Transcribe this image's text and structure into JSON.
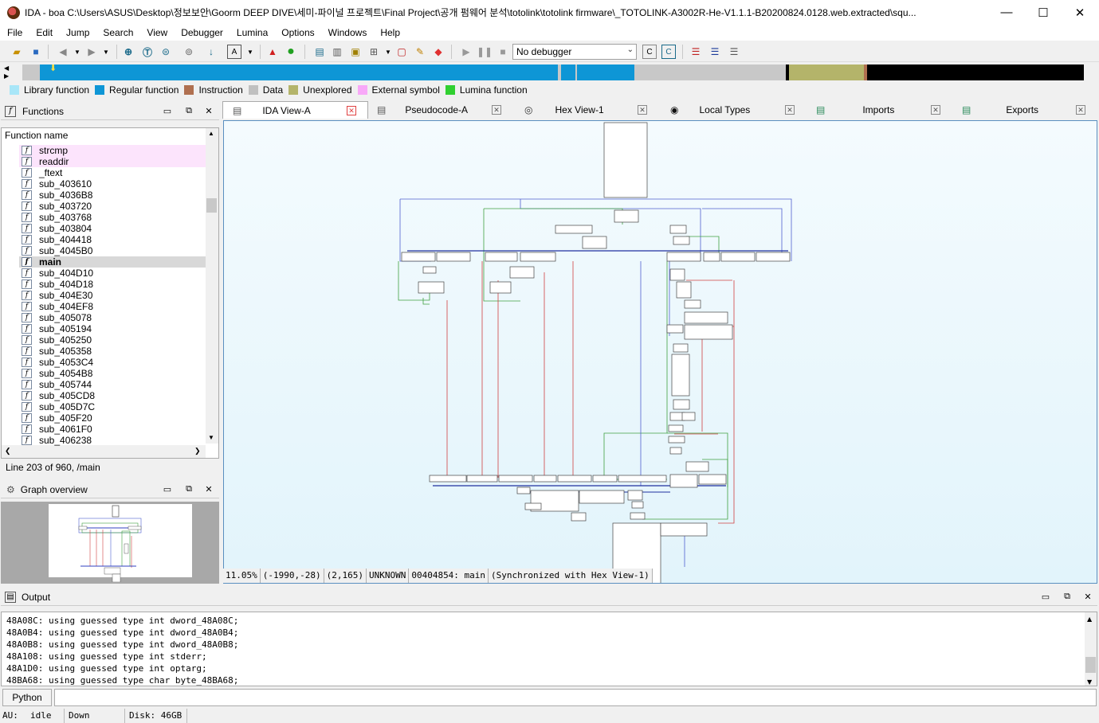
{
  "window": {
    "title": "IDA - boa C:\\Users\\ASUS\\Desktop\\정보보안\\Goorm DEEP DIVE\\세미-파이널 프로젝트\\Final Project\\공개 펌웨어 분석\\totolink\\totolink firmware\\_TOTOLINK-A3002R-He-V1.1.1-B20200824.0128.web.extracted\\squ...",
    "minimize": "—",
    "maximize": "☐",
    "close": "✕"
  },
  "menu": [
    "File",
    "Edit",
    "Jump",
    "Search",
    "View",
    "Debugger",
    "Lumina",
    "Options",
    "Windows",
    "Help"
  ],
  "toolbar": {
    "debugger_select": "No debugger"
  },
  "legend": [
    {
      "label": "Library function",
      "color": "#a8e6f8"
    },
    {
      "label": "Regular function",
      "color": "#0e96d6"
    },
    {
      "label": "Instruction",
      "color": "#b07050"
    },
    {
      "label": "Data",
      "color": "#c0c0c0"
    },
    {
      "label": "Unexplored",
      "color": "#b4b46a"
    },
    {
      "label": "External symbol",
      "color": "#f8a8f8"
    },
    {
      "label": "Lumina function",
      "color": "#30d030"
    }
  ],
  "functions_panel": {
    "title": "Functions",
    "column_header": "Function name",
    "items": [
      "strcmp",
      "readdir",
      "_ftext",
      "sub_403610",
      "sub_4036B8",
      "sub_403720",
      "sub_403768",
      "sub_403804",
      "sub_404418",
      "sub_4045B0",
      "main",
      "sub_404D10",
      "sub_404D18",
      "sub_404E30",
      "sub_404EF8",
      "sub_405078",
      "sub_405194",
      "sub_405250",
      "sub_405358",
      "sub_4053C4",
      "sub_4054B8",
      "sub_405744",
      "sub_405CD8",
      "sub_405D7C",
      "sub_405F20",
      "sub_4061F0",
      "sub_406238"
    ],
    "status": "Line 203 of 960, /main"
  },
  "graph_overview": {
    "title": "Graph overview"
  },
  "tabs": [
    {
      "label": "IDA View-A",
      "active": true
    },
    {
      "label": "Pseudocode-A",
      "active": false
    },
    {
      "label": "Hex View-1",
      "active": false
    },
    {
      "label": "Local Types",
      "active": false
    },
    {
      "label": "Imports",
      "active": false
    },
    {
      "label": "Exports",
      "active": false
    }
  ],
  "graph_status": {
    "zoom": "11.05%",
    "coords1": "(-1990,-28)",
    "coords2": "(2,165)",
    "segment": "UNKNOWN",
    "location": "00404854: main",
    "sync": "(Synchronized with Hex View-1)"
  },
  "output": {
    "title": "Output",
    "lines": [
      "48A08C: using guessed type int dword_48A08C;",
      "48A0B4: using guessed type int dword_48A0B4;",
      "48A0B8: using guessed type int dword_48A0B8;",
      "48A108: using guessed type int stderr;",
      "48A1D0: using guessed type int optarg;",
      "48BA68: using guessed type char byte_48BA68;"
    ],
    "python_label": "Python"
  },
  "statusbar": {
    "au_label": "AU:",
    "au_value": "idle",
    "direction": "Down",
    "disk": "Disk: 46GB"
  }
}
